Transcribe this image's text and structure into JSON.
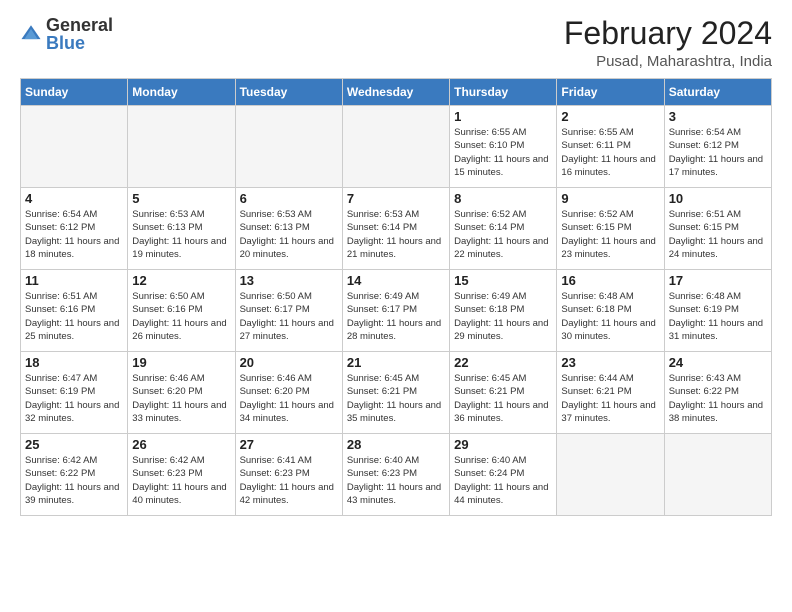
{
  "logo": {
    "general": "General",
    "blue": "Blue"
  },
  "header": {
    "title": "February 2024",
    "location": "Pusad, Maharashtra, India"
  },
  "weekdays": [
    "Sunday",
    "Monday",
    "Tuesday",
    "Wednesday",
    "Thursday",
    "Friday",
    "Saturday"
  ],
  "weeks": [
    [
      {
        "day": "",
        "info": ""
      },
      {
        "day": "",
        "info": ""
      },
      {
        "day": "",
        "info": ""
      },
      {
        "day": "",
        "info": ""
      },
      {
        "day": "1",
        "info": "Sunrise: 6:55 AM\nSunset: 6:10 PM\nDaylight: 11 hours and 15 minutes."
      },
      {
        "day": "2",
        "info": "Sunrise: 6:55 AM\nSunset: 6:11 PM\nDaylight: 11 hours and 16 minutes."
      },
      {
        "day": "3",
        "info": "Sunrise: 6:54 AM\nSunset: 6:12 PM\nDaylight: 11 hours and 17 minutes."
      }
    ],
    [
      {
        "day": "4",
        "info": "Sunrise: 6:54 AM\nSunset: 6:12 PM\nDaylight: 11 hours and 18 minutes."
      },
      {
        "day": "5",
        "info": "Sunrise: 6:53 AM\nSunset: 6:13 PM\nDaylight: 11 hours and 19 minutes."
      },
      {
        "day": "6",
        "info": "Sunrise: 6:53 AM\nSunset: 6:13 PM\nDaylight: 11 hours and 20 minutes."
      },
      {
        "day": "7",
        "info": "Sunrise: 6:53 AM\nSunset: 6:14 PM\nDaylight: 11 hours and 21 minutes."
      },
      {
        "day": "8",
        "info": "Sunrise: 6:52 AM\nSunset: 6:14 PM\nDaylight: 11 hours and 22 minutes."
      },
      {
        "day": "9",
        "info": "Sunrise: 6:52 AM\nSunset: 6:15 PM\nDaylight: 11 hours and 23 minutes."
      },
      {
        "day": "10",
        "info": "Sunrise: 6:51 AM\nSunset: 6:15 PM\nDaylight: 11 hours and 24 minutes."
      }
    ],
    [
      {
        "day": "11",
        "info": "Sunrise: 6:51 AM\nSunset: 6:16 PM\nDaylight: 11 hours and 25 minutes."
      },
      {
        "day": "12",
        "info": "Sunrise: 6:50 AM\nSunset: 6:16 PM\nDaylight: 11 hours and 26 minutes."
      },
      {
        "day": "13",
        "info": "Sunrise: 6:50 AM\nSunset: 6:17 PM\nDaylight: 11 hours and 27 minutes."
      },
      {
        "day": "14",
        "info": "Sunrise: 6:49 AM\nSunset: 6:17 PM\nDaylight: 11 hours and 28 minutes."
      },
      {
        "day": "15",
        "info": "Sunrise: 6:49 AM\nSunset: 6:18 PM\nDaylight: 11 hours and 29 minutes."
      },
      {
        "day": "16",
        "info": "Sunrise: 6:48 AM\nSunset: 6:18 PM\nDaylight: 11 hours and 30 minutes."
      },
      {
        "day": "17",
        "info": "Sunrise: 6:48 AM\nSunset: 6:19 PM\nDaylight: 11 hours and 31 minutes."
      }
    ],
    [
      {
        "day": "18",
        "info": "Sunrise: 6:47 AM\nSunset: 6:19 PM\nDaylight: 11 hours and 32 minutes."
      },
      {
        "day": "19",
        "info": "Sunrise: 6:46 AM\nSunset: 6:20 PM\nDaylight: 11 hours and 33 minutes."
      },
      {
        "day": "20",
        "info": "Sunrise: 6:46 AM\nSunset: 6:20 PM\nDaylight: 11 hours and 34 minutes."
      },
      {
        "day": "21",
        "info": "Sunrise: 6:45 AM\nSunset: 6:21 PM\nDaylight: 11 hours and 35 minutes."
      },
      {
        "day": "22",
        "info": "Sunrise: 6:45 AM\nSunset: 6:21 PM\nDaylight: 11 hours and 36 minutes."
      },
      {
        "day": "23",
        "info": "Sunrise: 6:44 AM\nSunset: 6:21 PM\nDaylight: 11 hours and 37 minutes."
      },
      {
        "day": "24",
        "info": "Sunrise: 6:43 AM\nSunset: 6:22 PM\nDaylight: 11 hours and 38 minutes."
      }
    ],
    [
      {
        "day": "25",
        "info": "Sunrise: 6:42 AM\nSunset: 6:22 PM\nDaylight: 11 hours and 39 minutes."
      },
      {
        "day": "26",
        "info": "Sunrise: 6:42 AM\nSunset: 6:23 PM\nDaylight: 11 hours and 40 minutes."
      },
      {
        "day": "27",
        "info": "Sunrise: 6:41 AM\nSunset: 6:23 PM\nDaylight: 11 hours and 42 minutes."
      },
      {
        "day": "28",
        "info": "Sunrise: 6:40 AM\nSunset: 6:23 PM\nDaylight: 11 hours and 43 minutes."
      },
      {
        "day": "29",
        "info": "Sunrise: 6:40 AM\nSunset: 6:24 PM\nDaylight: 11 hours and 44 minutes."
      },
      {
        "day": "",
        "info": ""
      },
      {
        "day": "",
        "info": ""
      }
    ]
  ]
}
